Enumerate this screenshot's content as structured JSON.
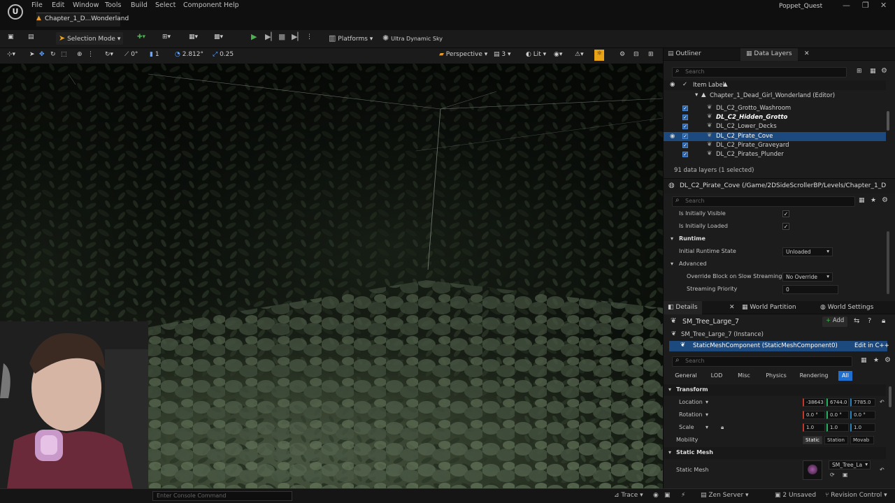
{
  "app": {
    "menus": [
      "File",
      "Edit",
      "Window",
      "Tools",
      "Build",
      "Select",
      "Component",
      "Help"
    ],
    "project": "Poppet_Quest",
    "level_tab": "Chapter_1_D...Wonderland"
  },
  "toolbar": {
    "selection_mode": "Selection Mode",
    "platforms": "Platforms",
    "sky": "Ultra Dynamic Sky"
  },
  "viewport": {
    "grid_angle": "0°",
    "grid_snap": "1",
    "scale_snap": "2.812°",
    "camera_speed": "0.25",
    "perspective": "Perspective",
    "fov_count": "3",
    "lit": "Lit"
  },
  "outliner": {
    "tab_outliner": "Outliner",
    "tab_data_layers": "Data Layers",
    "search_placeholder": "Search",
    "header": "Item Label",
    "root": "Chapter_1_Dead_Girl_Wonderland (Editor)",
    "items": [
      {
        "label": "DL_C2_Grotto_Washroom",
        "bold": false
      },
      {
        "label": "DL_C2_Hidden_Grotto",
        "bold": true
      },
      {
        "label": "DL_C2_Lower_Decks",
        "bold": false
      },
      {
        "label": "DL_C2_Pirate_Cove",
        "bold": false,
        "selected": true
      },
      {
        "label": "DL_C2_Pirate_Graveyard",
        "bold": false
      },
      {
        "label": "DL_C2_Pirates_Plunder",
        "bold": false
      }
    ],
    "count": "91 data layers (1 selected)"
  },
  "datalayer": {
    "title": "DL_C2_Pirate_Cove (/Game/2DSideScrollerBP/Levels/Chapter_1_D",
    "search_placeholder": "Search",
    "is_initially_visible": "Is Initially Visible",
    "is_initially_loaded": "Is Initially Loaded",
    "runtime": "Runtime",
    "initial_runtime_state": "Initial Runtime State",
    "initial_runtime_state_value": "Unloaded",
    "advanced": "Advanced",
    "override_block": "Override Block on Slow Streaming",
    "override_block_value": "No Override",
    "streaming_priority": "Streaming Priority",
    "streaming_priority_value": "0"
  },
  "details": {
    "tab_details": "Details",
    "tab_world_partition": "World Partition",
    "tab_world_settings": "World Settings",
    "actor": "SM_Tree_Large_7",
    "add": "Add",
    "instance": "SM_Tree_Large_7 (Instance)",
    "component": "StaticMeshComponent (StaticMeshComponent0)",
    "edit_cpp": "Edit in C++",
    "search_placeholder": "Search",
    "filters": [
      "General",
      "LOD",
      "Misc",
      "Physics",
      "Rendering",
      "All"
    ],
    "transform": "Transform",
    "location": "Location",
    "location_values": [
      "-38643",
      "6744.0",
      "7785.0"
    ],
    "rotation": "Rotation",
    "rotation_values": [
      "0.0 °",
      "0.0 °",
      "0.0 °"
    ],
    "scale": "Scale",
    "scale_values": [
      "1.0",
      "1.0",
      "1.0"
    ],
    "mobility": "Mobility",
    "mobility_options": [
      "Static",
      "Station",
      "Movab"
    ],
    "static_mesh_cat": "Static Mesh",
    "static_mesh": "Static Mesh",
    "static_mesh_value": "SM_Tree_La"
  },
  "statusbar": {
    "console_placeholder": "Enter Console Command",
    "trace": "Trace",
    "zen": "Zen Server",
    "unsaved": "2 Unsaved",
    "revision": "Revision Control"
  },
  "colors": {
    "accent": "#1d4a7e",
    "play_green": "#4caf50",
    "highlight_yellow": "#e8a317"
  }
}
